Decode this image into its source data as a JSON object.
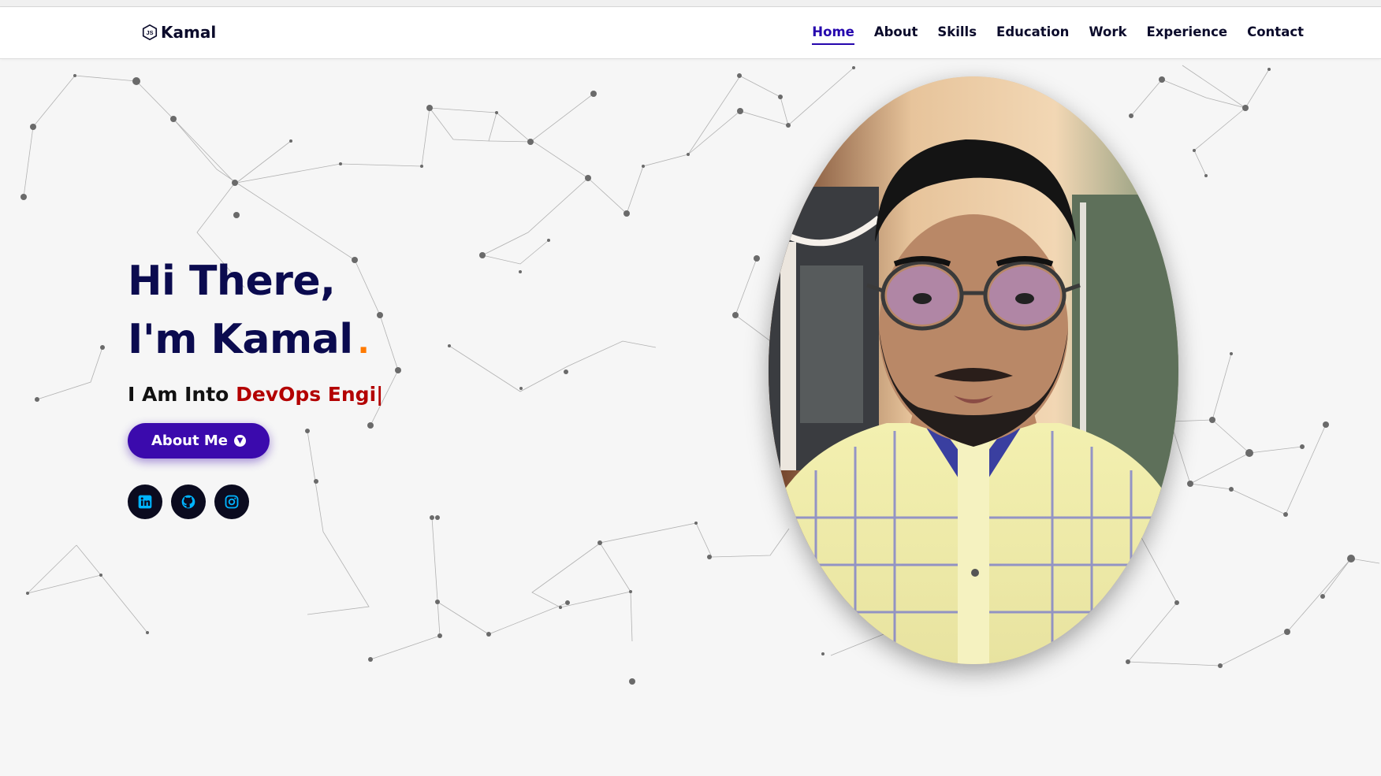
{
  "brand": {
    "name": "Kamal",
    "icon": "js-hexagon-icon"
  },
  "nav": {
    "items": [
      "Home",
      "About",
      "Skills",
      "Education",
      "Work",
      "Experience",
      "Contact"
    ],
    "active": "Home"
  },
  "hero": {
    "line1": "Hi There,",
    "line2": "I'm Kamal",
    "dot": ".",
    "typing_prefix": "I Am Into",
    "typing_role": "DevOps Engi|",
    "about_button": "About Me",
    "socials": [
      "linkedin-icon",
      "github-icon",
      "instagram-icon"
    ]
  },
  "colors": {
    "accent": "#2506ad",
    "heading": "#0b0b4f",
    "role": "#b30000",
    "dot": "#ff7a00",
    "social_icon": "#00b4ff"
  }
}
